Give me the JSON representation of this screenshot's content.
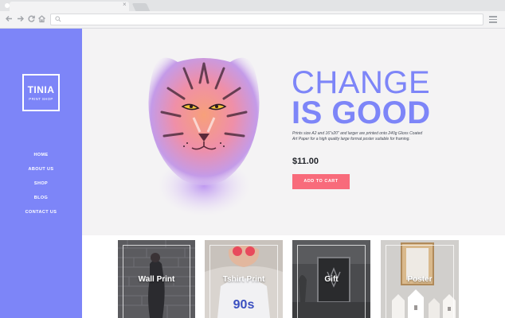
{
  "browser": {
    "tab_close": "×",
    "icons": [
      "back-arrow-icon",
      "forward-arrow-icon",
      "reload-icon",
      "home-icon",
      "search-icon",
      "menu-icon"
    ]
  },
  "sidebar": {
    "logo_title": "TINIA",
    "logo_subtitle": "PRINT SHOP",
    "nav": [
      {
        "label": "HOME"
      },
      {
        "label": "ABOUT US"
      },
      {
        "label": "SHOP"
      },
      {
        "label": "BLOG"
      },
      {
        "label": "CONTACT US"
      }
    ],
    "color": "#7d85f8"
  },
  "hero": {
    "headline_line1": "CHANGE",
    "headline_line2": "IS GOOD",
    "description": "Prints size A2 and 16\"x20\" and larger are printed onto 240g Gloss Coated Art Paper for a high quality large format poster suitable for framing.",
    "price": "$11.00",
    "cart_button": "ADD TO CART",
    "accent": "#7d85f8",
    "button_color": "#f86b7b"
  },
  "categories": [
    {
      "label": "Wall Print"
    },
    {
      "label": "Tshirt Print"
    },
    {
      "label": "Gift"
    },
    {
      "label": "Poster"
    }
  ]
}
